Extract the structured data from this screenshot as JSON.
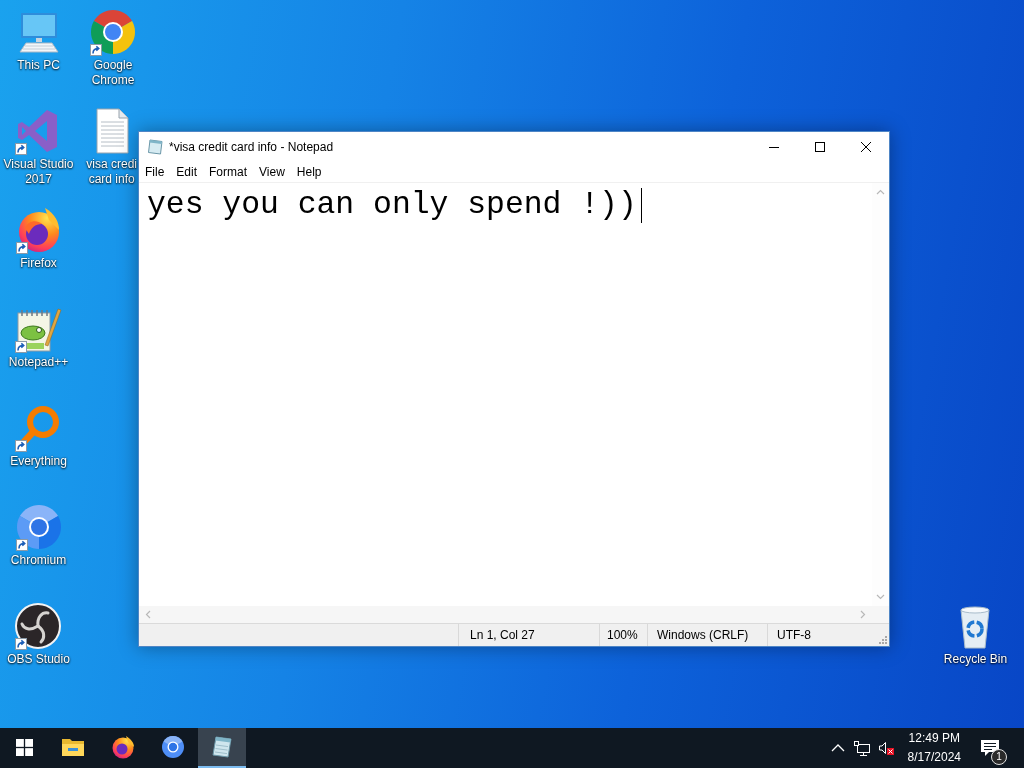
{
  "desktop": {
    "icons": [
      {
        "kind": "computer",
        "label": [
          "This PC"
        ],
        "shortcut": false
      },
      {
        "kind": "ide",
        "label": [
          "Visual Studio",
          "2017"
        ],
        "shortcut": true
      },
      {
        "kind": "fox",
        "label": [
          "Firefox"
        ],
        "shortcut": true
      },
      {
        "kind": "notepad-plus",
        "label": [
          "Notepad++"
        ],
        "shortcut": true
      },
      {
        "kind": "magnifier",
        "label": [
          "Everything"
        ],
        "shortcut": true
      },
      {
        "kind": "blue-browser",
        "label": [
          "Chromium"
        ],
        "shortcut": true
      },
      {
        "kind": "recorder",
        "label": [
          "OBS Studio"
        ],
        "shortcut": true
      },
      {
        "kind": "color-browser",
        "label": [
          "Google",
          "Chrome"
        ],
        "shortcut": true
      },
      {
        "kind": "document",
        "label": [
          "visa credi",
          "card info"
        ],
        "shortcut": false
      }
    ],
    "recycle_bin": {
      "kind": "recycle-bin",
      "label": [
        "Recycle Bin"
      ],
      "shortcut": false
    }
  },
  "window": {
    "title": "*visa credit card info - Notepad",
    "menu": [
      "File",
      "Edit",
      "Format",
      "View",
      "Help"
    ],
    "document": "yes you can only spend !))",
    "status_bar": [
      "Ln 1, Col 27",
      "100%",
      "Windows (CRLF)",
      "UTF-8"
    ]
  },
  "taskbar": {
    "apps": [
      {
        "kind": "folder",
        "selected": false
      },
      {
        "kind": "fox",
        "selected": false
      },
      {
        "kind": "blue-browser",
        "selected": false
      },
      {
        "kind": "notepad",
        "selected": true
      }
    ],
    "tray": {
      "volume_muted": true,
      "time": "12:49 PM",
      "date": "8/17/2024",
      "notifications": "1"
    }
  }
}
